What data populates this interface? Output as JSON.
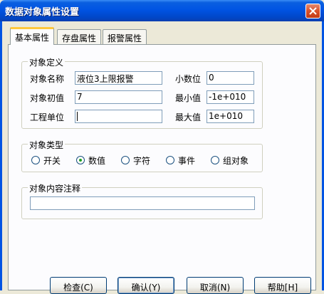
{
  "window": {
    "title": "数据对象属性设置"
  },
  "tabs": [
    {
      "label": "基本属性",
      "active": true
    },
    {
      "label": "存盘属性",
      "active": false
    },
    {
      "label": "报警属性",
      "active": false
    }
  ],
  "definition": {
    "group_label": "对象定义",
    "name_label": "对象名称",
    "name_value": "液位3上限报警",
    "initial_label": "对象初值",
    "initial_value": "7",
    "unit_label": "工程单位",
    "unit_value": "",
    "decimals_label": "小数位",
    "decimals_value": "0",
    "min_label": "最小值",
    "min_value": "-1e+010",
    "max_label": "最大值",
    "max_value": "1e+010"
  },
  "type_group": {
    "group_label": "对象类型",
    "options": [
      {
        "label": "开关",
        "selected": false
      },
      {
        "label": "数值",
        "selected": true
      },
      {
        "label": "字符",
        "selected": false
      },
      {
        "label": "事件",
        "selected": false
      },
      {
        "label": "组对象",
        "selected": false
      }
    ]
  },
  "comment": {
    "group_label": "对象内容注释",
    "value": ""
  },
  "buttons": {
    "check": "检查(C)",
    "confirm": "确认(Y)",
    "cancel": "取消(N)",
    "help": "帮助[H]"
  },
  "colors": {
    "titlebar": "#0054e3",
    "dialog_bg": "#ece9d8",
    "panel_bg": "#fcfcfe",
    "radio_dot": "#21a121"
  }
}
